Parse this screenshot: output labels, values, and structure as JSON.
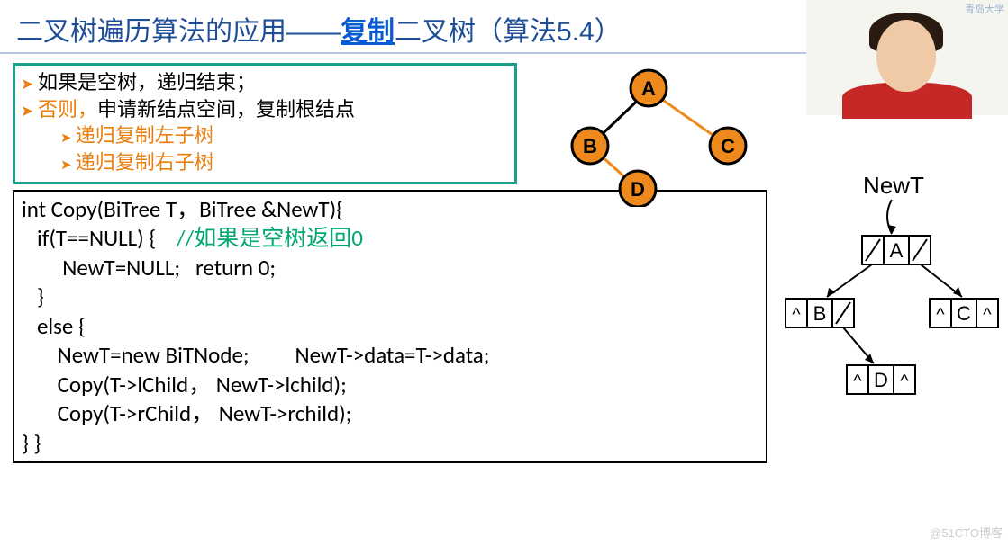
{
  "title": {
    "pre": "二叉树遍历算法的应用——",
    "accent": "复制",
    "post": "二叉树（算法5.4）"
  },
  "algo": {
    "l1a": "如果是空树，递归结束；",
    "l2a": "否则，",
    "l2b": "申请新结点空间，复制根结点",
    "l3": "递归复制左子树",
    "l4": "递归复制右子树"
  },
  "code": {
    "l1": "int Copy(BiTree T，BiTree &NewT){",
    "l2a": "   if(T==NULL) {    ",
    "l2b": "//如果是空树返回0",
    "l3": "        NewT=NULL;   return 0;",
    "l4": "   }",
    "l5": "   else {",
    "l6": "       NewT=new BiTNode;         NewT->data=T->data;",
    "l7": "       Copy(T->lChild， NewT->lchild);",
    "l8": "       Copy(T->rChild， NewT->rchild);",
    "l9": "} }"
  },
  "tree": {
    "A": "A",
    "B": "B",
    "C": "C",
    "D": "D"
  },
  "newt": {
    "label": "NewT",
    "A": "A",
    "B": "B",
    "C": "C",
    "D": "D"
  },
  "watermark": "@51CTO博客",
  "webcam_caption": "青岛大学"
}
